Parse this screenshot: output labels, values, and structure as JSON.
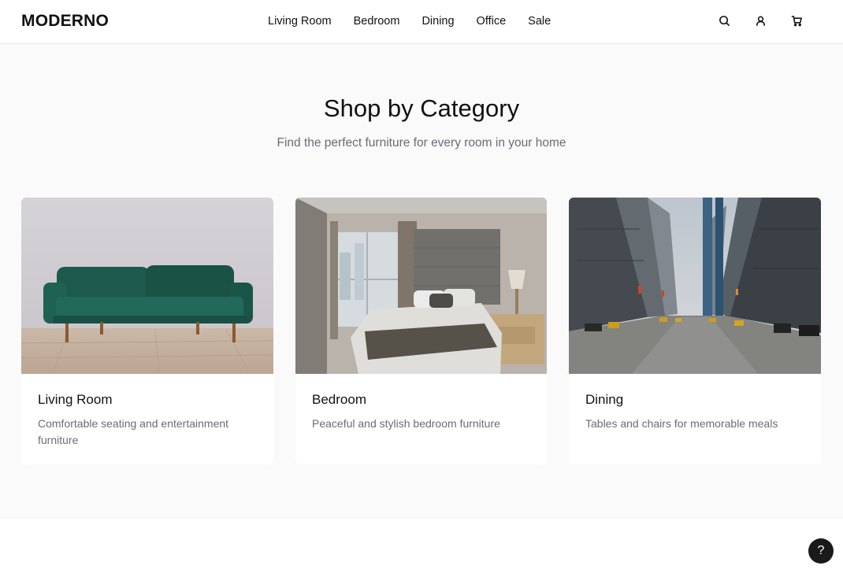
{
  "header": {
    "logo": "MODERNO",
    "nav": [
      "Living Room",
      "Bedroom",
      "Dining",
      "Office",
      "Sale"
    ],
    "icons": [
      "search-icon",
      "user-icon",
      "cart-icon"
    ]
  },
  "categories_section": {
    "title": "Shop by Category",
    "subtitle": "Find the perfect furniture for every room in your home",
    "cards": [
      {
        "title": "Living Room",
        "description": "Comfortable seating and entertainment furniture"
      },
      {
        "title": "Bedroom",
        "description": "Peaceful and stylish bedroom furniture"
      },
      {
        "title": "Dining",
        "description": "Tables and chairs for memorable meals"
      }
    ]
  },
  "help": {
    "label": "?"
  },
  "colors": {
    "text": "#111111",
    "muted_text": "#6b6b76",
    "section_background": "#fafafa",
    "help_button": "#1a1a1a"
  }
}
